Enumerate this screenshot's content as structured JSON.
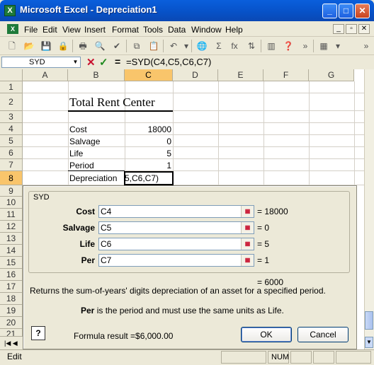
{
  "window": {
    "title": "Microsoft Excel - Depreciation1",
    "app_icon": "X",
    "minimize": "_",
    "maximize": "□",
    "close": "✕"
  },
  "menu": {
    "items": [
      "File",
      "Edit",
      "View",
      "Insert",
      "Format",
      "Tools",
      "Data",
      "Window",
      "Help"
    ],
    "mdi_min": "_",
    "mdi_restore": "▫",
    "mdi_close": "✕"
  },
  "formula_bar": {
    "name_box": "SYD",
    "cancel": "✕",
    "enter": "✓",
    "equals": "=",
    "formula": "=SYD(C4,C5,C6,C7)"
  },
  "grid": {
    "columns": [
      "A",
      "B",
      "C",
      "D",
      "E",
      "F",
      "G"
    ],
    "rows": [
      "1",
      "2",
      "3",
      "4",
      "5",
      "6",
      "7",
      "8",
      "9",
      "10",
      "11",
      "12",
      "13",
      "14",
      "15",
      "16",
      "17",
      "18",
      "19",
      "20",
      "21"
    ],
    "title": "Total Rent Center",
    "cells": {
      "b4": "Cost",
      "c4": "18000",
      "b5": "Salvage",
      "c5": "0",
      "b6": "Life",
      "c6": "5",
      "b7": "Period",
      "c7": "1",
      "b8": "Depreciation",
      "c8": "5,C6,C7)"
    }
  },
  "dialog": {
    "group_label": "SYD",
    "args": [
      {
        "label": "Cost",
        "input": "C4",
        "value": "= 18000"
      },
      {
        "label": "Salvage",
        "input": "C5",
        "value": "= 0"
      },
      {
        "label": "Life",
        "input": "C6",
        "value": "= 5"
      },
      {
        "label": "Per",
        "input": "C7",
        "value": "= 1"
      }
    ],
    "result": "= 6000",
    "description": "Returns the sum-of-years' digits depreciation of an asset for a specified period.",
    "arg_desc_name": "Per",
    "arg_desc_text": " is the period and must use the same units as Life.",
    "help": "?",
    "formula_result": "Formula result =$6,000.00",
    "ok": "OK",
    "cancel": "Cancel"
  },
  "status": {
    "mode": "Edit",
    "num": "NUM"
  }
}
